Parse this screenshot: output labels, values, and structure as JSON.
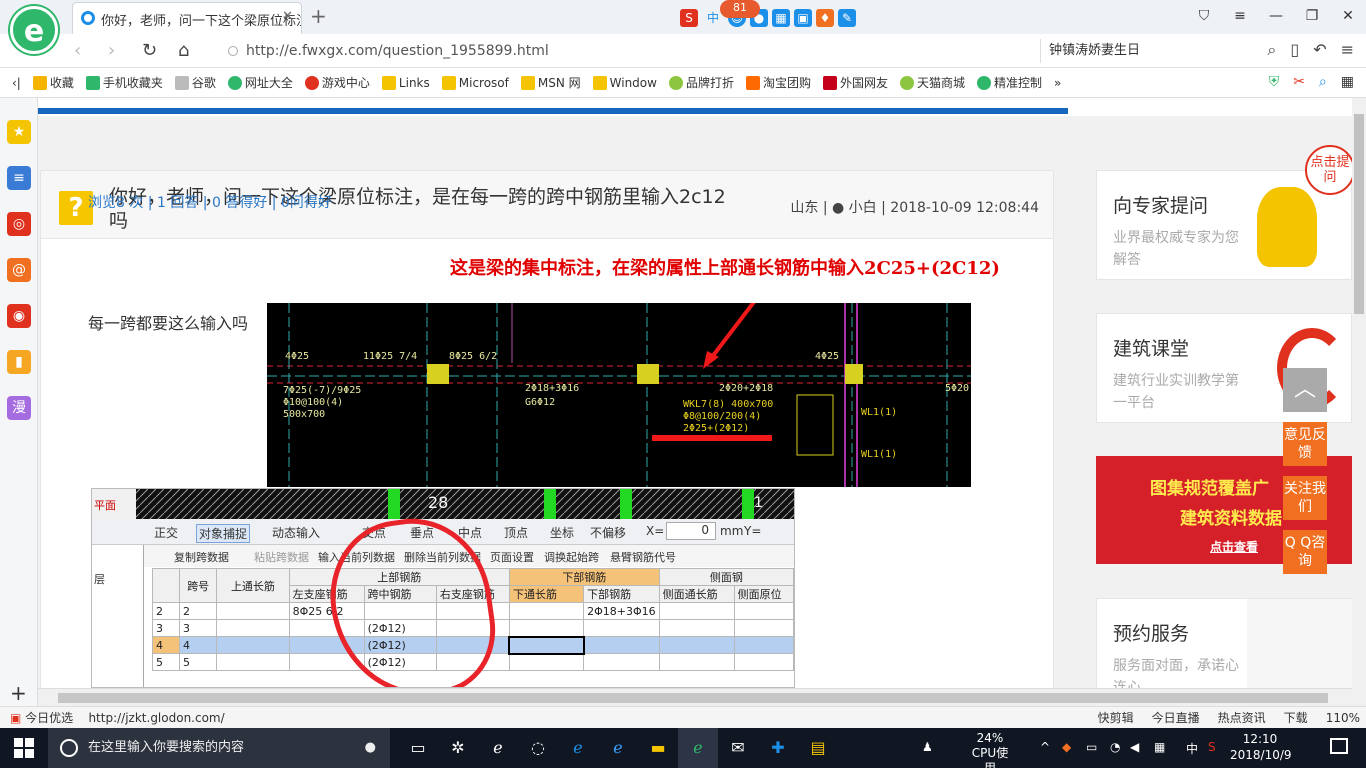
{
  "browser": {
    "tab_title": "你好，老师，问一下这个梁原位标注，是",
    "url": "http://e.fwxgx.com/question_1955899.html",
    "search_text": "钟镇涛娇妻生日",
    "badge": "81",
    "ime_label": "中"
  },
  "bookmarks": [
    {
      "label": "收藏",
      "color": "#f5b400"
    },
    {
      "label": "手机收藏夹",
      "color": "#2fb86b"
    },
    {
      "label": "谷歌",
      "color": "#999999"
    },
    {
      "label": "网址大全",
      "color": "#2fb86b"
    },
    {
      "label": "游戏中心",
      "color": "#e0301e"
    },
    {
      "label": "Links",
      "color": "#f5c400"
    },
    {
      "label": "Microsof",
      "color": "#f5c400"
    },
    {
      "label": "MSN 网",
      "color": "#f5c400"
    },
    {
      "label": "Window",
      "color": "#f5c400"
    },
    {
      "label": "品牌打折",
      "color": "#8cc63f"
    },
    {
      "label": "淘宝团购",
      "color": "#ff6a00"
    },
    {
      "label": "外国网友",
      "color": "#c4001a"
    },
    {
      "label": "天猫商城",
      "color": "#8cc63f"
    },
    {
      "label": "精准控制",
      "color": "#2fb86b"
    }
  ],
  "question": {
    "title": "你好，老师，问一下这个梁原位标注，是在每一跨的跨中钢筋里输入2c12吗",
    "location": "山东",
    "user": "小白",
    "datetime": "2018-10-09 12:08:44",
    "stats": "浏览8 次 | 1 回答 | 0 答得好 | 0问得好",
    "body": "每一跨都要这么输入吗",
    "annotation": "这是梁的集中标注，在梁的属性上部通长钢筋中输入2C25+(2C12)"
  },
  "cad": {
    "labels": [
      "4Φ25",
      "11Φ25 7/4",
      "8Φ25 6/2",
      "4Φ25",
      "5Φ20",
      "7Φ25(-7)/9Φ25",
      "Φ10@100(4)",
      "500x700",
      "2Φ18+3Φ16",
      "G6Φ12",
      "2Φ20+2Φ18",
      "WKL7(8) 400x700",
      "Φ8@100/200(4)",
      "2Φ25+(2Φ12)",
      "WL1(1)",
      "WL1(1)"
    ],
    "span_numbers": [
      "28",
      "1"
    ]
  },
  "software": {
    "toolbar": [
      "正交",
      "对象捕捉",
      "动态输入",
      "交点",
      "垂点",
      "中点",
      "顶点",
      "坐标",
      "不偏移",
      "X=",
      "0",
      "mm",
      "Y="
    ],
    "toolbar2": [
      "复制跨数据",
      "粘贴跨数据",
      "输入当前列数据",
      "删除当前列数据",
      "页面设置",
      "调换起始跨",
      "悬臂钢筋代号"
    ],
    "left_panel": [
      "平面",
      "层"
    ],
    "group_headers": [
      "上部钢筋",
      "下部钢筋",
      "侧面钢"
    ],
    "headers": [
      "跨号",
      "上通长筋",
      "左支座钢筋",
      "跨中钢筋",
      "右支座钢筋",
      "下通长筋",
      "下部钢筋",
      "侧面通长筋",
      "侧面原位"
    ],
    "rows": [
      {
        "idx": "2",
        "span": "2",
        "left": "8Φ25 6/2",
        "mid": "",
        "bottom": "2Φ18+3Φ16"
      },
      {
        "idx": "3",
        "span": "3",
        "left": "",
        "mid": "(2Φ12)",
        "bottom": ""
      },
      {
        "idx": "4",
        "span": "4",
        "left": "",
        "mid": "(2Φ12)",
        "bottom": ""
      },
      {
        "idx": "5",
        "span": "5",
        "left": "",
        "mid": "(2Φ12)",
        "bottom": ""
      }
    ]
  },
  "sidebar_right": {
    "expert_title": "向专家提问",
    "expert_desc": "业界最权威专家为您解答",
    "class_title": "建筑课堂",
    "class_desc": "建筑行业实训教学第一平台",
    "banner_line1": "图集规范覆盖广",
    "banner_line2": "建筑资料数据",
    "banner_link": "点击查看",
    "booking_title": "预约服务",
    "booking_desc": "服务面对面，承诺心连心",
    "corner_badge": "点击提问"
  },
  "float_buttons": [
    "意见反馈",
    "关注我们",
    "Q Q咨询"
  ],
  "statusbar": {
    "left": "今日优选",
    "url": "http://jzkt.glodon.com/",
    "items": [
      "快剪辑",
      "今日直播",
      "热点资讯",
      "下载",
      "110%"
    ]
  },
  "taskbar": {
    "search_placeholder": "在这里输入你要搜索的内容",
    "cpu_percent": "24%",
    "cpu_label": "CPU使用",
    "time": "12:10",
    "date": "2018/10/9",
    "ime": "中"
  },
  "colors": {
    "accent_blue": "#1766bd",
    "annotation_red": "#e00000",
    "logo_green": "#2fb86b"
  }
}
